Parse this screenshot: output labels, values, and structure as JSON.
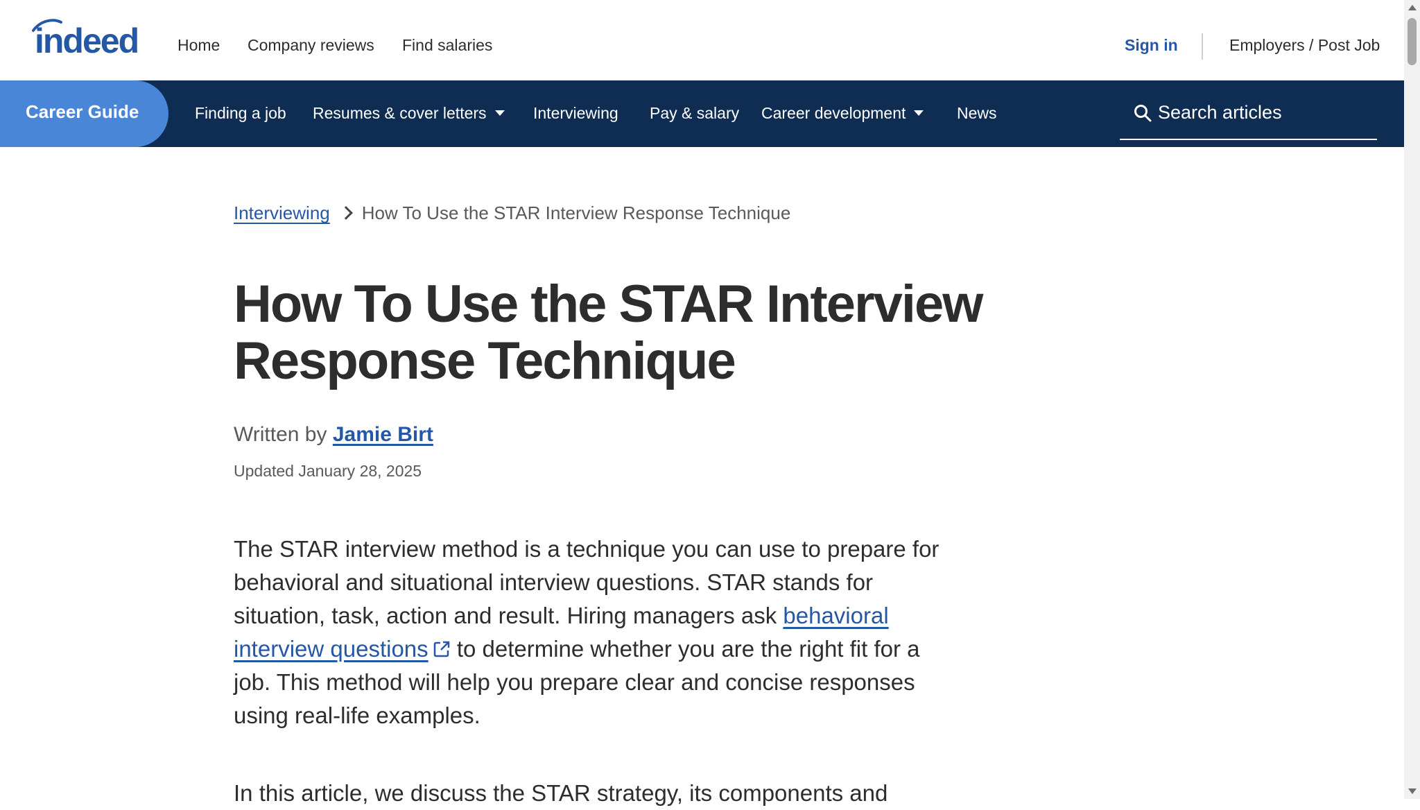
{
  "header": {
    "logo_text": "indeed",
    "nav": [
      "Home",
      "Company reviews",
      "Find salaries"
    ],
    "sign_in": "Sign in",
    "employers": "Employers / Post Job"
  },
  "career_nav": {
    "guide_label": "Career Guide",
    "items": [
      {
        "label": "Finding a job"
      },
      {
        "label": "Resumes & cover letters",
        "dropdown": true
      },
      {
        "label": "Interviewing"
      },
      {
        "label": "Pay & salary"
      },
      {
        "label": "Career development",
        "dropdown": true
      },
      {
        "label": "News"
      }
    ],
    "search_placeholder": "Search articles"
  },
  "breadcrumb": {
    "parent": "Interviewing",
    "current": "How To Use the STAR Interview Response Technique"
  },
  "article": {
    "title": "How To Use the STAR Interview Response Technique",
    "written_by_prefix": "Written by",
    "author": "Jamie Birt",
    "updated": "Updated January 28, 2025",
    "p1_before": "The STAR interview method is a technique you can use to prepare for behavioral and situational interview questions. STAR stands for situation, task, action and result. Hiring managers ask ",
    "p1_link": "behavioral interview questions",
    "p1_after": " to determine whether you are the right fit for a job. This method will help you prepare clear and concise responses using real-life examples.",
    "p2": "In this article, we discuss the STAR strategy, its components and"
  },
  "colors": {
    "brand_blue": "#2557a7",
    "nav_bg": "#0f2d52",
    "guide_tab": "#4a86d8",
    "text": "#2d2d2d"
  }
}
